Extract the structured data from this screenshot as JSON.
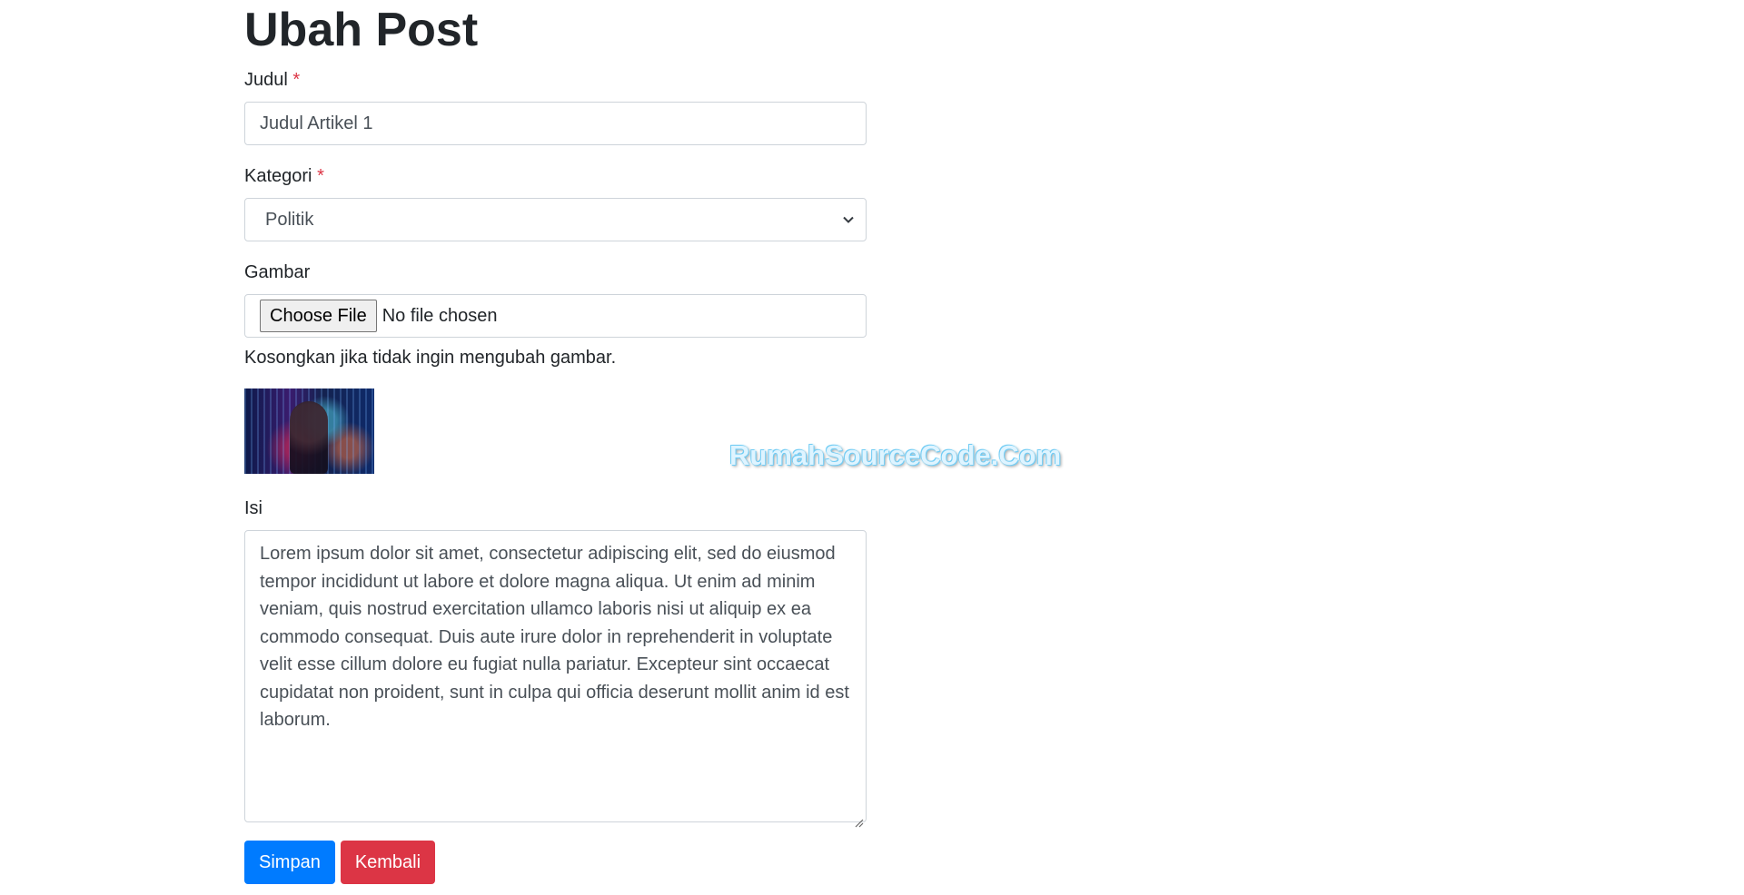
{
  "page": {
    "title": "Ubah Post"
  },
  "form": {
    "judul": {
      "label": "Judul",
      "required_mark": "*",
      "value": "Judul Artikel 1"
    },
    "kategori": {
      "label": "Kategori",
      "required_mark": "*",
      "selected": "Politik"
    },
    "gambar": {
      "label": "Gambar",
      "button_label": "Choose File",
      "status": "No file chosen",
      "help": "Kosongkan jika tidak ingin mengubah gambar."
    },
    "isi": {
      "label": "Isi",
      "value": "Lorem ipsum dolor sit amet, consectetur adipiscing elit, sed do eiusmod tempor incididunt ut labore et dolore magna aliqua. Ut enim ad minim veniam, quis nostrud exercitation ullamco laboris nisi ut aliquip ex ea commodo consequat. Duis aute irure dolor in reprehenderit in voluptate velit esse cillum dolore eu fugiat nulla pariatur. Excepteur sint occaecat cupidatat non proident, sunt in culpa qui officia deserunt mollit anim id est laborum."
    },
    "buttons": {
      "save": "Simpan",
      "back": "Kembali"
    }
  },
  "watermark": "RumahSourceCode.Com",
  "colors": {
    "primary": "#007bff",
    "danger": "#dc3545",
    "required": "#dc3545"
  },
  "icons": {
    "select_arrow": "chevron-down-icon",
    "textarea_grip": "resize-grip-icon"
  }
}
